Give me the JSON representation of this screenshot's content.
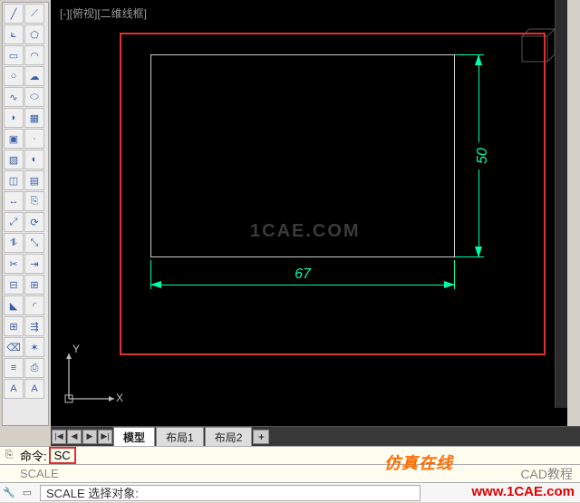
{
  "view_label": "[-][俯视][二维线框]",
  "dimensions": {
    "width": "67",
    "height": "50"
  },
  "watermark_center": "1CAE.COM",
  "ucs": {
    "x": "X",
    "y": "Y"
  },
  "tabs": {
    "nav": [
      "|◀",
      "◀",
      "▶",
      "▶|"
    ],
    "model": "模型",
    "layout1": "布局1",
    "layout2": "布局2",
    "plus": "+"
  },
  "command": {
    "prefix": "命令:",
    "typed": "SC",
    "echo": "SCALE",
    "prompt": "SCALE 选择对象:"
  },
  "watermarks": {
    "brand": "仿真在线",
    "cad": "CAD教程",
    "url": "www.1CAE.com"
  },
  "tool_names": [
    "line",
    "construction-line",
    "polyline",
    "polygon",
    "rectangle",
    "arc",
    "circle",
    "revision-cloud",
    "spline",
    "ellipse",
    "ellipse-arc",
    "insert-block",
    "make-block",
    "point",
    "hatch",
    "gradient",
    "region",
    "table",
    "move",
    "copy",
    "stretch",
    "rotate",
    "mirror",
    "scale",
    "trim",
    "extend",
    "break",
    "join",
    "chamfer",
    "fillet",
    "array",
    "offset",
    "erase",
    "explode",
    "properties",
    "match-properties",
    "text",
    "mtext"
  ],
  "tool_glyphs": [
    "╱",
    "⟋",
    "⟀",
    "⬠",
    "▭",
    "◠",
    "○",
    "☁",
    "∿",
    "⬭",
    "◗",
    "▦",
    "▣",
    "·",
    "▧",
    "◐",
    "◫",
    "▤",
    "↔",
    "⎘",
    "⤢",
    "⟳",
    "⥮",
    "⤡",
    "✂",
    "⇥",
    "⊟",
    "⊞",
    "◣",
    "◜",
    "⊞",
    "⇶",
    "⌫",
    "✶",
    "≡",
    "⎙",
    "A",
    "A"
  ]
}
